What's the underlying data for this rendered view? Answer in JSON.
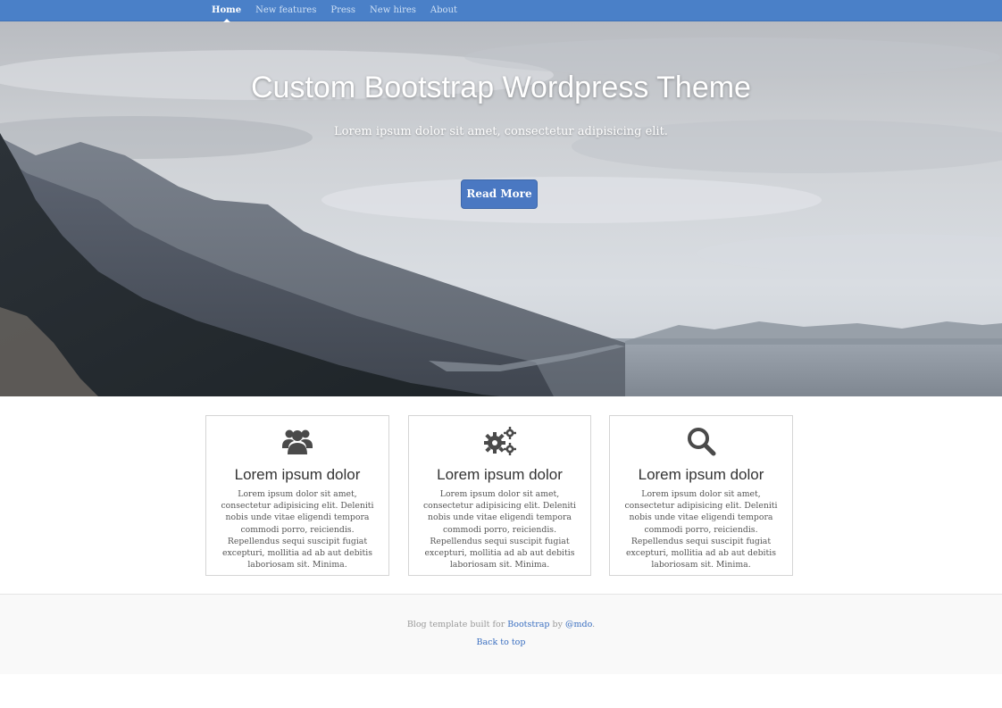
{
  "nav": {
    "items": [
      {
        "label": "Home",
        "active": true
      },
      {
        "label": "New features",
        "active": false
      },
      {
        "label": "Press",
        "active": false
      },
      {
        "label": "New hires",
        "active": false
      },
      {
        "label": "About",
        "active": false
      }
    ]
  },
  "hero": {
    "title": "Custom Bootstrap Wordpress Theme",
    "subtitle": "Lorem ipsum dolor sit amet, consectetur adipisicing elit.",
    "button_label": "Read More"
  },
  "features": [
    {
      "icon": "users-icon",
      "title": "Lorem ipsum dolor",
      "text": "Lorem ipsum dolor sit amet, consectetur adipisicing elit. Deleniti nobis unde vitae eligendi tempora commodi porro, reiciendis. Repellendus sequi suscipit fugiat excepturi, mollitia ad ab aut debitis laboriosam sit. Minima."
    },
    {
      "icon": "gears-icon",
      "title": "Lorem ipsum dolor",
      "text": "Lorem ipsum dolor sit amet, consectetur adipisicing elit. Deleniti nobis unde vitae eligendi tempora commodi porro, reiciendis. Repellendus sequi suscipit fugiat excepturi, mollitia ad ab aut debitis laboriosam sit. Minima."
    },
    {
      "icon": "search-icon",
      "title": "Lorem ipsum dolor",
      "text": "Lorem ipsum dolor sit amet, consectetur adipisicing elit. Deleniti nobis unde vitae eligendi tempora commodi porro, reiciendis. Repellendus sequi suscipit fugiat excepturi, mollitia ad ab aut debitis laboriosam sit. Minima."
    }
  ],
  "footer": {
    "prefix": "Blog template built for ",
    "bootstrap_link": "Bootstrap",
    "by": " by ",
    "author_link": "@mdo",
    "suffix": ".",
    "back_to_top": "Back to top"
  },
  "colors": {
    "nav_bg": "#4a80c8",
    "button_bg": "#4a78c2",
    "link": "#3a6fc0"
  }
}
